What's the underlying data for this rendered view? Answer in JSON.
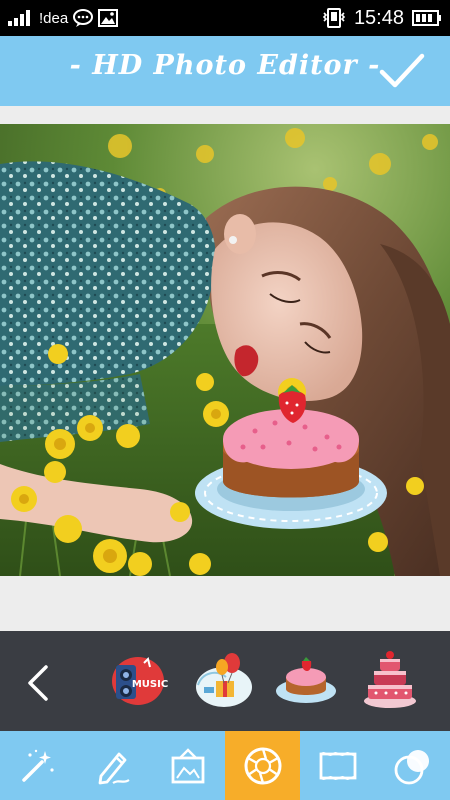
{
  "status_bar": {
    "carrier": "!dea",
    "time": "15:48"
  },
  "header": {
    "title": "- HD Photo Editor -"
  },
  "stickers": {
    "items": [
      "music-sticker",
      "gift-balloon-sticker",
      "cake-plate-sticker",
      "tiered-cake-sticker"
    ]
  },
  "toolbar": {
    "tools": [
      "magic-wand-icon",
      "pencil-icon",
      "frame-icon",
      "aperture-icon",
      "border-icon",
      "overlay-icon"
    ],
    "active_tool": "aperture-icon"
  },
  "colors": {
    "accent": "#7fc9f1",
    "active": "#f7ad29",
    "sticker_bar": "#3a3d43"
  }
}
